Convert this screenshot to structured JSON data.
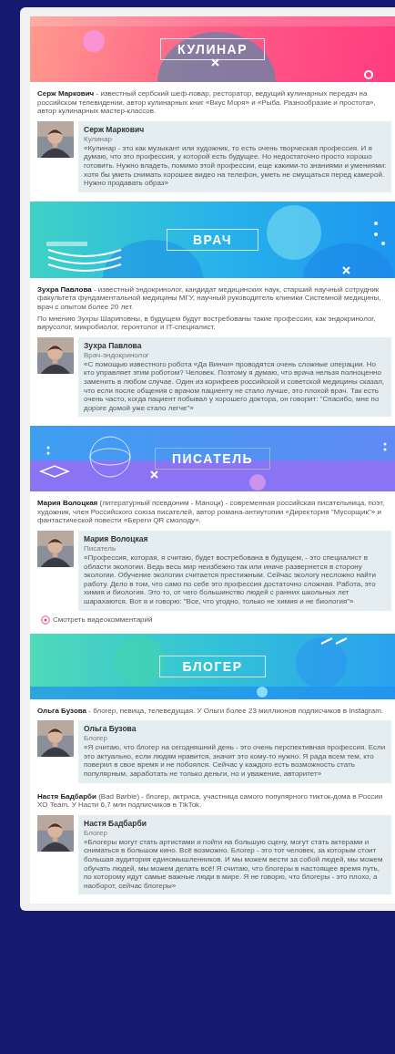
{
  "sections": [
    {
      "title": "КУЛИНАР",
      "kind": "culinary",
      "people": [
        {
          "intro": [
            "**Серж Маркович** - известный сербский шеф-повар, ресторатор, ведущий кулинарных передач на российском телевидении, автор кулинарных книг «Вкус Моря» и «Рыба. Разнообразие и простота», автор кулинарных мастер-классов."
          ],
          "quote": {
            "name": "Серж Маркович",
            "role": "Кулинар",
            "text": "«Кулинар - это как музыкант или художник, то есть очень творческая профессия. И я думаю, что это профессия, у которой есть будущее. Но недостаточно просто хорошо готовить. Нужно владеть, помимо этой профессии, еще какими-то знаниями и умениями: хотя бы уметь снимать хорошее видео на телефон, уметь не смущаться перед камерой. Нужно продавать образ»"
          }
        }
      ]
    },
    {
      "title": "ВРАЧ",
      "kind": "doctor",
      "people": [
        {
          "intro": [
            "**Зухра Павлова** - известный эндокринолог, кандидат медицинских наук, старший научный сотрудник факультета фундаментальной медицины МГУ, научный руководитель клиники Системной медицины, врач с опытом более 20 лет.",
            "По мнению Зухры Шариповны, в будущем будут востребованы такие профессии, как эндокринолог, вирусолог, микробиолог, геронтолог и IT-специалист."
          ],
          "quote": {
            "name": "Зухра Павлова",
            "role": "Врач-эндокринолог",
            "text": "«С помощью известного робота «Да Винчи» проводятся очень сложные операции. Но кто управляет этим роботом? Человек. Поэтому я думаю, что врача нельзя полноценно заменить в любом случае. Один из корифеев российской и советской медицины сказал, что если после общения с врачом пациенту не стало лучше, это плохой врач. Так есть очень часто, когда пациент побывал у хорошего доктора, он говорит: \"Спасибо, мне по дороге домой уже стало легче\"»"
          }
        }
      ]
    },
    {
      "title": "ПИСАТЕЛЬ",
      "kind": "writer",
      "people": [
        {
          "intro": [
            "**Мария Волоцкая** (литературный псевдоним - Маноцк) - современная российская писательница, поэт, художник, член Российского союза писателей, автор романа-антиутопии «Директория \"Мусорщик\"» и фантастической повести «Береги QR смолоду»."
          ],
          "quote": {
            "name": "Мария Волоцкая",
            "role": "Писатель",
            "text": "«Профессия, которая, я считаю, будет востребована в будущем, - это специалист в области экологии. Ведь весь мир неизбежно так или иначе развернется в сторону экологии. Обучение экологии считается престижным. Сейчас экологу несложно найти работу. Дело в том, что само по себе это профессия достаточно сложная. Работа, это химия и биология. Это то, от чего большинство людей с ранних школьных лет шарахаются. Вот я и говорю: \"Все, что угодно, только не химия и не биология\"»"
          },
          "video_link": "Смотреть видеокомментарий"
        }
      ]
    },
    {
      "title": "БЛОГЕР",
      "kind": "blogger",
      "people": [
        {
          "intro": [
            "**Ольга Бузова** - блогер, певица, телеведущая. У Ольги более 23 миллионов подписчиков в Instagram."
          ],
          "quote": {
            "name": "Ольга Бузова",
            "role": "Блогер",
            "text": "«Я считаю, что блогер на сегодняшний день - это очень перспективная профессия. Если это актуально, если людям нравится, значит это кому-то нужно. Я рада всем тем, кто поверил в свое время и не побоялся. Сейчас у каждого есть возможность стать популярным, заработать не только деньги, но и уважение, авторитет»"
          }
        },
        {
          "intro": [
            "**Настя Бадбарби** (Bad Barbie) - блогер, актриса, участница самого популярного тикток-дома в России XO Team. У Насти 6,7 млн подписчиков в TikTok."
          ],
          "quote": {
            "name": "Настя Бадбарби",
            "role": "Блогер",
            "text": "«Блогеры могут стать артистами и пойти на большую сцену, могут стать актерами и сниматься в большом кино. Всё возможно. Блогер - это тот человек, за которым стоит большая аудитория единомышленников. И мы можем вести за собой людей, мы можем обучать людей, мы можем делать всё! Я считаю, что блогеры в настоящее время путь, по которому идут самые важные люди в мире. Я не говорю, что блогеры - это плохо, а наоборот, сейчас блогеры»"
          }
        }
      ]
    }
  ]
}
